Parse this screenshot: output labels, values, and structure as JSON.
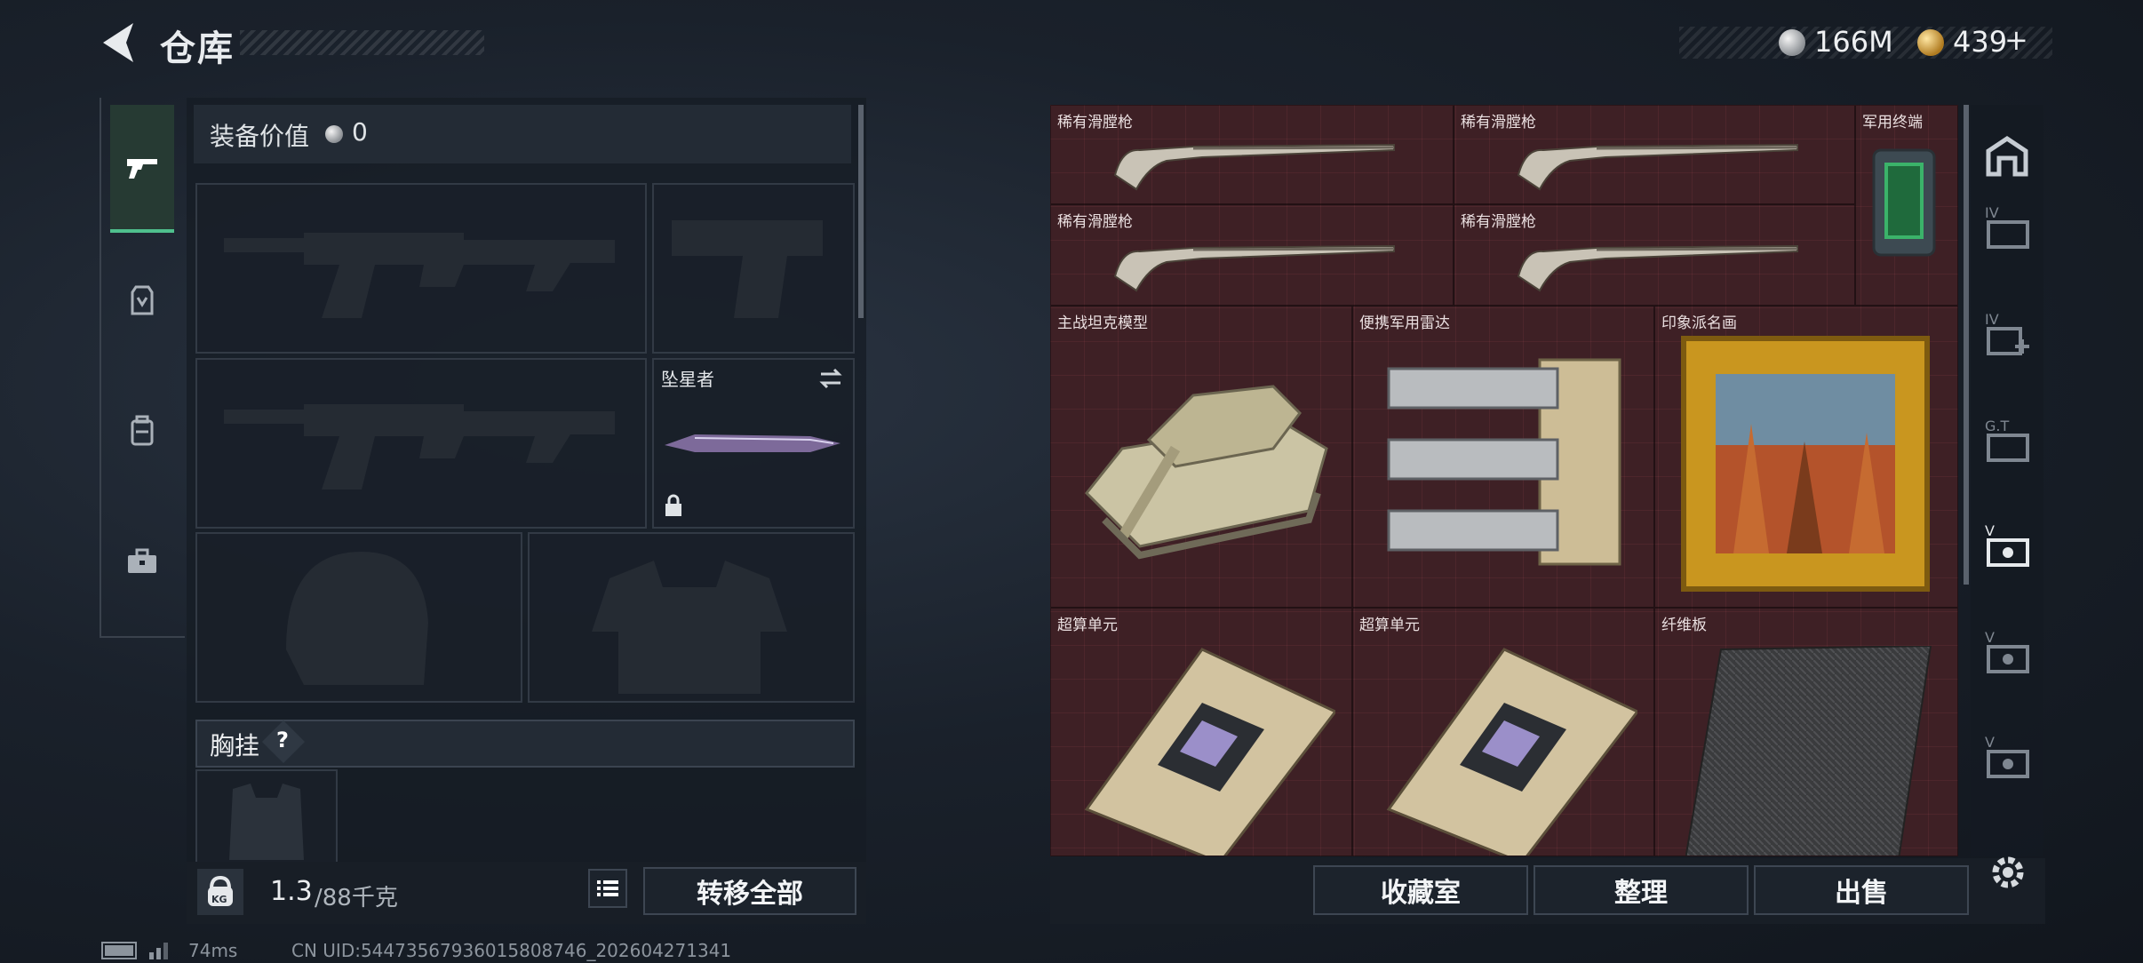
{
  "header": {
    "title": "仓库",
    "silver_amount": "166M",
    "gold_amount": "439",
    "plus": "+"
  },
  "equipment": {
    "value_label": "装备价值",
    "value": "0",
    "melee_name": "坠星者",
    "chest_label": "胸挂",
    "help": "?",
    "weight": "1.3",
    "weight_max": "/88千克",
    "weight_icon_text": "KG",
    "transfer_all": "转移全部"
  },
  "storage": {
    "items": [
      {
        "label": "稀有滑膛枪"
      },
      {
        "label": "稀有滑膛枪"
      },
      {
        "label": "军用终端"
      },
      {
        "label": "稀有滑膛枪"
      },
      {
        "label": "稀有滑膛枪"
      },
      {
        "label": "主战坦克模型"
      },
      {
        "label": "便携军用雷达"
      },
      {
        "label": "印象派名画"
      },
      {
        "label": "超算单元"
      },
      {
        "label": "超算单元"
      },
      {
        "label": "纤维板"
      }
    ],
    "rail": [
      "IV",
      "IV",
      "G.T",
      "V",
      "V",
      "V"
    ],
    "buttons": {
      "collection": "收藏室",
      "organize": "整理",
      "sell": "出售"
    }
  },
  "status": {
    "ping": "74ms",
    "uid": "CN UID:54473567936015808746_202604271341"
  },
  "colors": {
    "accent_green": "#4fc08d",
    "grid_bg": "#3e2025"
  }
}
